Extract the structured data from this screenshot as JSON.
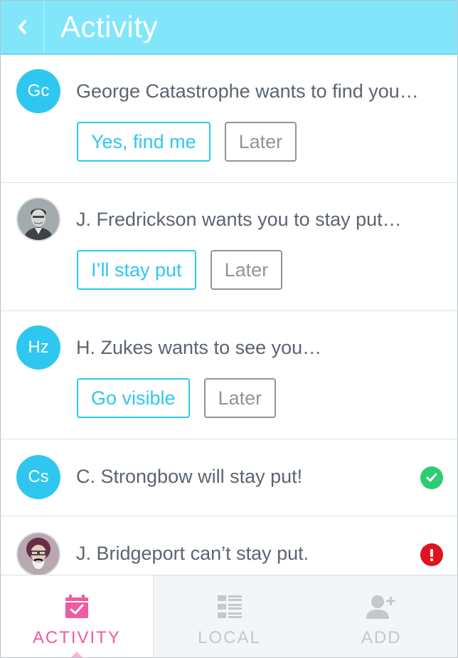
{
  "header": {
    "title": "Activity",
    "back_icon": "chevron-left-icon"
  },
  "items": [
    {
      "avatar_initials": "Gc",
      "message": "George Catastrophe wants to find you…",
      "primary_action": "Yes, find me",
      "secondary_action": "Later"
    },
    {
      "avatar_type": "photo",
      "message": "J. Fredrickson wants you to stay put…",
      "primary_action": "I’ll stay put",
      "secondary_action": "Later"
    },
    {
      "avatar_initials": "Hz",
      "message": "H. Zukes wants to see you…",
      "primary_action": "Go visible",
      "secondary_action": "Later"
    },
    {
      "avatar_initials": "Cs",
      "message": "C. Strongbow will stay put!",
      "status": "success",
      "status_icon": "check-circle-icon"
    },
    {
      "avatar_type": "photo",
      "message": "J. Bridgeport can’t stay put.",
      "status": "error",
      "status_icon": "exclamation-circle-icon"
    }
  ],
  "tabs": [
    {
      "label": "ACTIVITY",
      "icon": "calendar-check-icon",
      "active": true
    },
    {
      "label": "LOCAL",
      "icon": "list-icon",
      "active": false
    },
    {
      "label": "ADD",
      "icon": "add-user-icon",
      "active": false
    }
  ],
  "colors": {
    "header_bg": "#82e6fb",
    "accent": "#2fc7f0",
    "active_tab": "#f05aa0",
    "success": "#2ecc71",
    "error": "#e0121f"
  }
}
